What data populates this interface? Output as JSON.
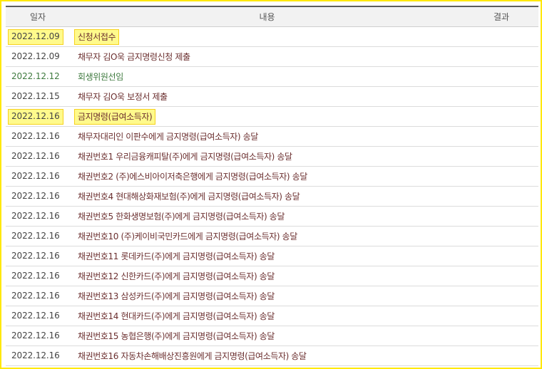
{
  "table": {
    "headers": {
      "date": "일자",
      "content": "내용",
      "result": "결과"
    },
    "colors": {
      "default": "#444444",
      "green": "#3f7a3f",
      "brown": "#6b2f2f",
      "highlight_fill": "#fffa8c",
      "highlight_border": "#f6d21e"
    },
    "rows": [
      {
        "date": "2022.12.09",
        "content": "신청서접수",
        "result": "",
        "highlighted": true,
        "color": "brown"
      },
      {
        "date": "2022.12.09",
        "content": "채무자 김O욱 금지명령신청 제출",
        "result": "",
        "highlighted": false,
        "color": "brown"
      },
      {
        "date": "2022.12.12",
        "content": "회생위원선임",
        "result": "",
        "highlighted": false,
        "color": "green"
      },
      {
        "date": "2022.12.15",
        "content": "채무자 김O욱 보정서 제출",
        "result": "",
        "highlighted": false,
        "color": "brown"
      },
      {
        "date": "2022.12.16",
        "content": "금지명령(급여소득자)",
        "result": "",
        "highlighted": true,
        "color": "brown"
      },
      {
        "date": "2022.12.16",
        "content": "채무자대리인 이판수에게 금지명령(급여소득자) 송달",
        "result": "",
        "highlighted": false,
        "color": "brown"
      },
      {
        "date": "2022.12.16",
        "content": "채권번호1 우리금융캐피탈(주)에게 금지명령(급여소득자) 송달",
        "result": "",
        "highlighted": false,
        "color": "brown"
      },
      {
        "date": "2022.12.16",
        "content": "채권번호2 (주)에스비아이저축은행에게 금지명령(급여소득자) 송달",
        "result": "",
        "highlighted": false,
        "color": "brown"
      },
      {
        "date": "2022.12.16",
        "content": "채권번호4 현대해상화재보험(주)에게 금지명령(급여소득자) 송달",
        "result": "",
        "highlighted": false,
        "color": "brown"
      },
      {
        "date": "2022.12.16",
        "content": "채권번호5 한화생명보험(주)에게 금지명령(급여소득자) 송달",
        "result": "",
        "highlighted": false,
        "color": "brown"
      },
      {
        "date": "2022.12.16",
        "content": "채권번호10 (주)케이비국민카드에게 금지명령(급여소득자) 송달",
        "result": "",
        "highlighted": false,
        "color": "brown"
      },
      {
        "date": "2022.12.16",
        "content": "채권번호11 롯데카드(주)에게 금지명령(급여소득자) 송달",
        "result": "",
        "highlighted": false,
        "color": "brown"
      },
      {
        "date": "2022.12.16",
        "content": "채권번호12 신한카드(주)에게 금지명령(급여소득자) 송달",
        "result": "",
        "highlighted": false,
        "color": "brown"
      },
      {
        "date": "2022.12.16",
        "content": "채권번호13 삼성카드(주)에게 금지명령(급여소득자) 송달",
        "result": "",
        "highlighted": false,
        "color": "brown"
      },
      {
        "date": "2022.12.16",
        "content": "채권번호14 현대카드(주)에게 금지명령(급여소득자) 송달",
        "result": "",
        "highlighted": false,
        "color": "brown"
      },
      {
        "date": "2022.12.16",
        "content": "채권번호15 농협은행(주)에게 금지명령(급여소득자) 송달",
        "result": "",
        "highlighted": false,
        "color": "brown"
      },
      {
        "date": "2022.12.16",
        "content": "채권번호16 자동차손해배상진흥원에게 금지명령(급여소득자) 송달",
        "result": "",
        "highlighted": false,
        "color": "brown"
      }
    ]
  }
}
